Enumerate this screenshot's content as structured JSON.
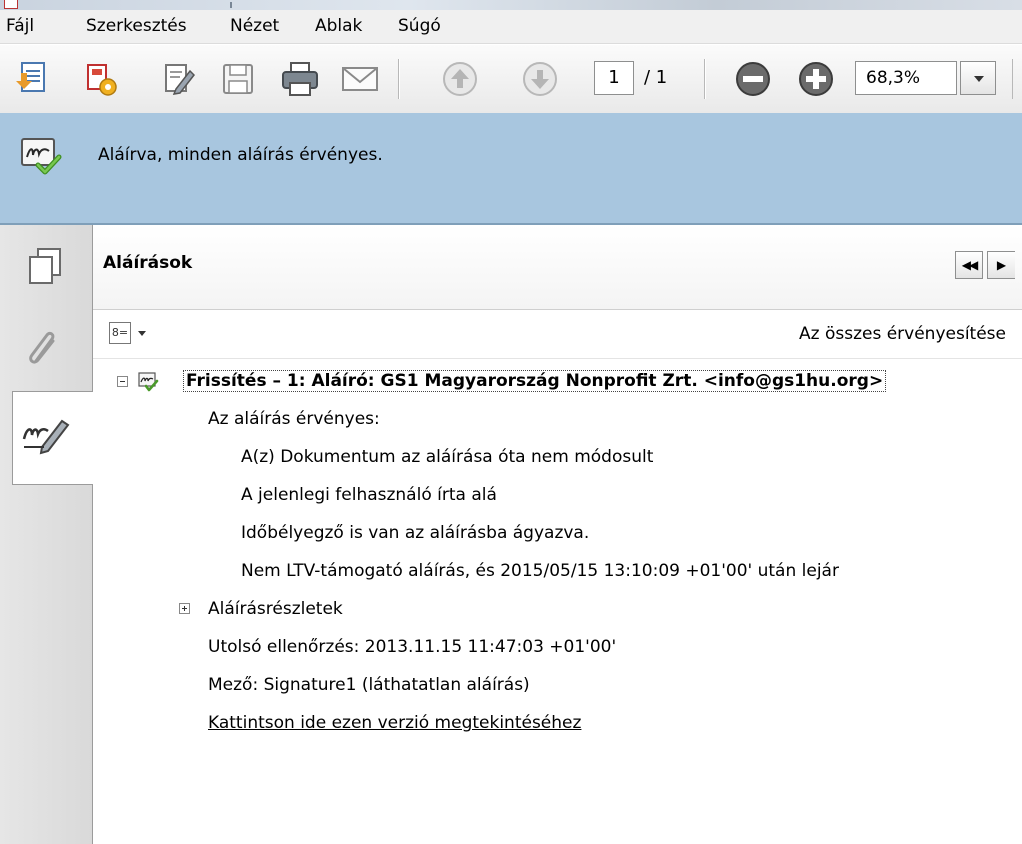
{
  "menu": [
    "Fájl",
    "Szerkesztés",
    "Nézet",
    "Ablak",
    "Súgó"
  ],
  "toolbar": {
    "icons": [
      "create-pdf-icon",
      "convert-icon",
      "edit-icon",
      "save-icon",
      "print-icon",
      "email-icon",
      "previous-page-icon",
      "next-page-icon",
      "zoom-out-icon",
      "zoom-in-icon"
    ],
    "page_current": "1",
    "page_total": "/ 1",
    "zoom": "68,3%"
  },
  "signature_bar": {
    "message": "Aláírva, minden aláírás érvényes."
  },
  "panel": {
    "title": "Aláírások",
    "validate_all": "Az összes érvényesítése",
    "signature": {
      "title": "Frissítés – 1: Aláíró: GS1 Magyarország Nonprofit Zrt. <info@gs1hu.org>",
      "status_heading": "Az aláírás érvényes:",
      "status_details": [
        "A(z) Dokumentum az aláírása óta nem módosult",
        "A jelenlegi felhasználó írta alá",
        "Időbélyegző is van az aláírásba ágyazva.",
        "Nem LTV-támogató aláírás, és 2015/05/15 13:10:09 +01'00' után lejár"
      ],
      "details_label": "Aláírásrészletek",
      "last_checked": "Utolsó ellenőrzés: 2013.11.15 11:47:03 +01'00'",
      "field": "Mező: Signature1 (láthatatlan aláírás)",
      "view_version_link": "Kattintson ide ezen verzió megtekintéséhez"
    }
  },
  "colors": {
    "signature_bar": "#a8c6df",
    "check_green": "#5aa82e"
  }
}
